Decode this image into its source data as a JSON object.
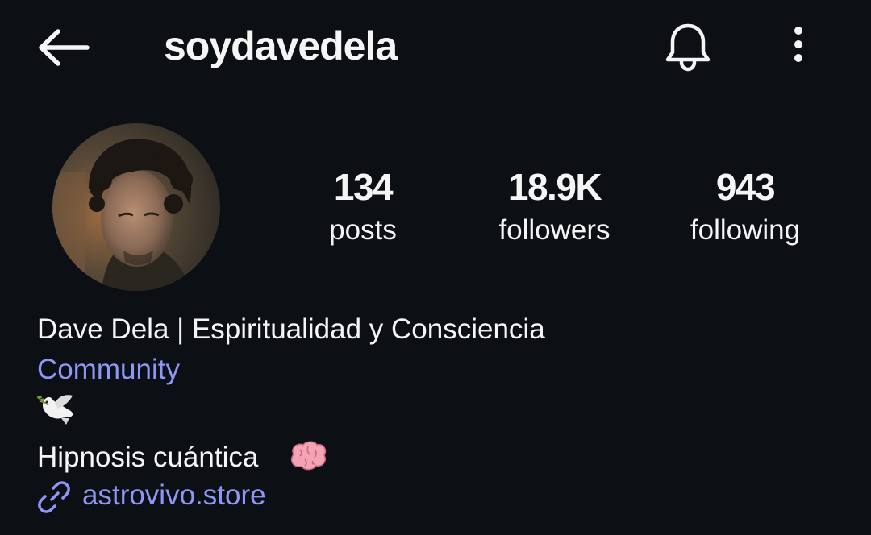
{
  "header": {
    "username": "soydavedela",
    "back_icon": "arrow-left-icon",
    "bell_icon": "bell-icon",
    "more_icon": "more-vertical-icon"
  },
  "profile": {
    "avatar_alt": "profile-photo",
    "stats": {
      "posts": {
        "value": "134",
        "label": "posts"
      },
      "followers": {
        "value": "18.9K",
        "label": "followers"
      },
      "following": {
        "value": "943",
        "label": "following"
      }
    }
  },
  "bio": {
    "name": "Dave Dela | Espiritualidad y Consciencia",
    "category": "Community",
    "emoji_line": "dove-emoji-icon",
    "line": "Hipnosis cuántica",
    "line_emoji": "brain-emoji-icon",
    "link": "astrovivo.store"
  },
  "colors": {
    "background": "#0c0f14",
    "text": "#f5f5f5",
    "link": "#8e97f5"
  }
}
